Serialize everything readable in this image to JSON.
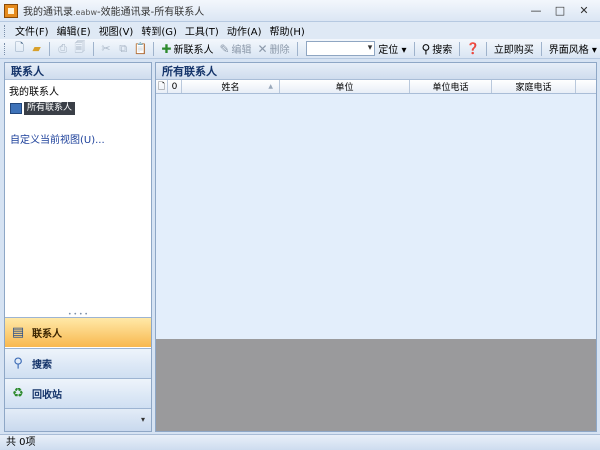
{
  "window": {
    "title_prefix": "我的通讯录",
    "title_ext": ".eabw",
    "title_suffix": "-效能通讯录-所有联系人",
    "minimize": "—",
    "maximize": "□",
    "close": "✕"
  },
  "menu": [
    "文件(F)",
    "编辑(E)",
    "视图(V)",
    "转到(G)",
    "工具(T)",
    "动作(A)",
    "帮助(H)"
  ],
  "toolbar": {
    "new_contact": "新联系人",
    "edit": "编辑",
    "delete": "删除",
    "search_value": "",
    "locate": "定位 ▾",
    "search": "搜索",
    "buy_now": "立即购买",
    "skin": "界面风格 ▾"
  },
  "left_panel": {
    "header": "联系人",
    "my_contacts": "我的联系人",
    "folder": "所有联系人",
    "custom_view": "自定义当前视图(U)...",
    "nav": {
      "contacts": "联系人",
      "search": "搜索",
      "recycle": "回收站"
    }
  },
  "main_panel": {
    "header": "所有联系人",
    "columns": [
      "姓名",
      "单位",
      "单位电话",
      "家庭电话"
    ]
  },
  "status": {
    "text": "共 0项"
  },
  "colors": {
    "active_nav": "#f8b84f",
    "panel_bg": "#e3eefb",
    "preview_bg": "#9a9a9c"
  }
}
